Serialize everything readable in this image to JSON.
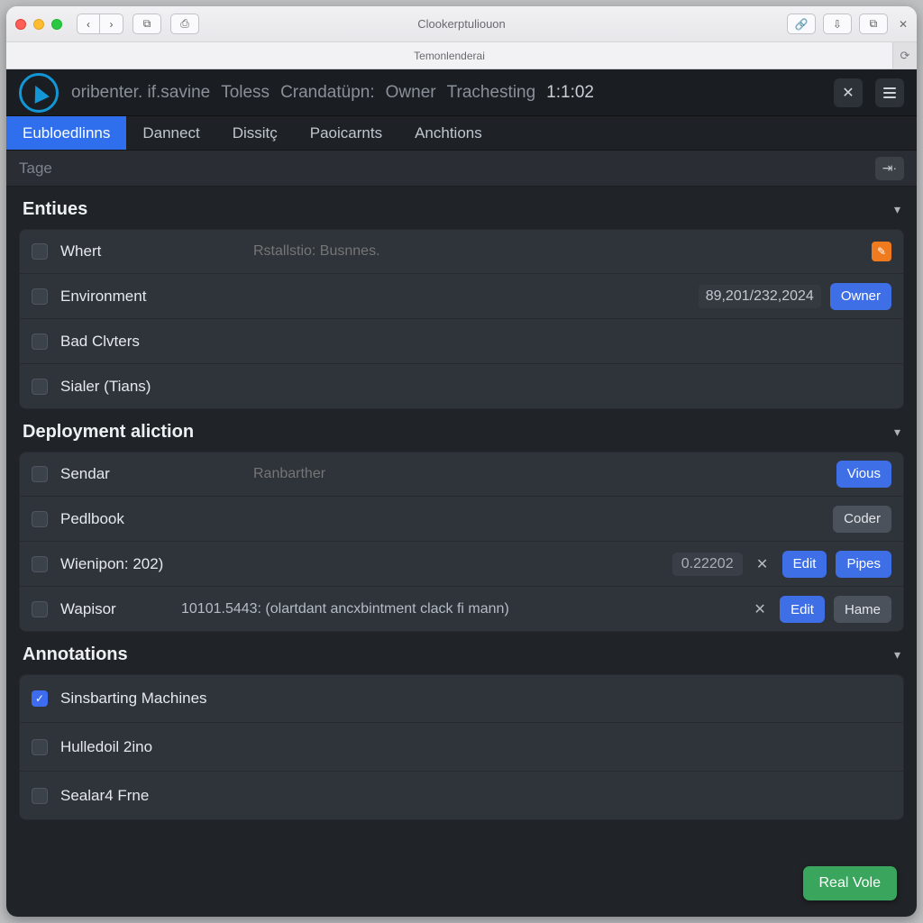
{
  "browser": {
    "title": "Clookerptuliouon",
    "tab": "Temonlenderai"
  },
  "header": {
    "crumbs": [
      "oribenter. if.savine",
      "Toless",
      "Crandatüpn:",
      "Owner",
      "Trachesting"
    ],
    "time": "1:1:02"
  },
  "tabs": [
    "Eubloedlinns",
    "Dannect",
    "Dissitç",
    "Paoicarnts",
    "Anchtions"
  ],
  "filter": {
    "placeholder": "Tage"
  },
  "sections": {
    "entities": {
      "title": "Entiues",
      "rows": [
        {
          "label": "Whert",
          "note_placeholder": "Rstallstio: Busnnes.",
          "edit_glyph": "✎"
        },
        {
          "label": "Environment",
          "date": "89,201/232,2024",
          "owner_label": "Owner"
        },
        {
          "label": "Bad Clvters"
        },
        {
          "label": "Sialer (Tians)"
        }
      ]
    },
    "deployment": {
      "title": "Deployment aliction",
      "rows": [
        {
          "label": "Sendar",
          "note_placeholder": "Ranbarther",
          "btn": "Vious",
          "btn_style": "blue"
        },
        {
          "label": "Pedlbook",
          "btn": "Coder",
          "btn_style": "gray"
        },
        {
          "label": "Wienipon: 202)",
          "num": "0.22202",
          "x": "✕",
          "btn1": "Edit",
          "btn2": "Pipes",
          "btn2_style": "blue"
        },
        {
          "label": "Wapisor",
          "note": "10101.5443:  (olartdant ancxbintment clack fi mann)",
          "x": "✕",
          "btn1": "Edit",
          "btn2": "Hame",
          "btn2_style": "gray"
        }
      ]
    },
    "annotations": {
      "title": "Annotations",
      "rows": [
        {
          "label": "Sinsbarting Machines",
          "checked": true
        },
        {
          "label": "Hulledoil 2ino"
        },
        {
          "label": "Sealar4 Frne"
        }
      ]
    }
  },
  "fab": "Real Vole"
}
